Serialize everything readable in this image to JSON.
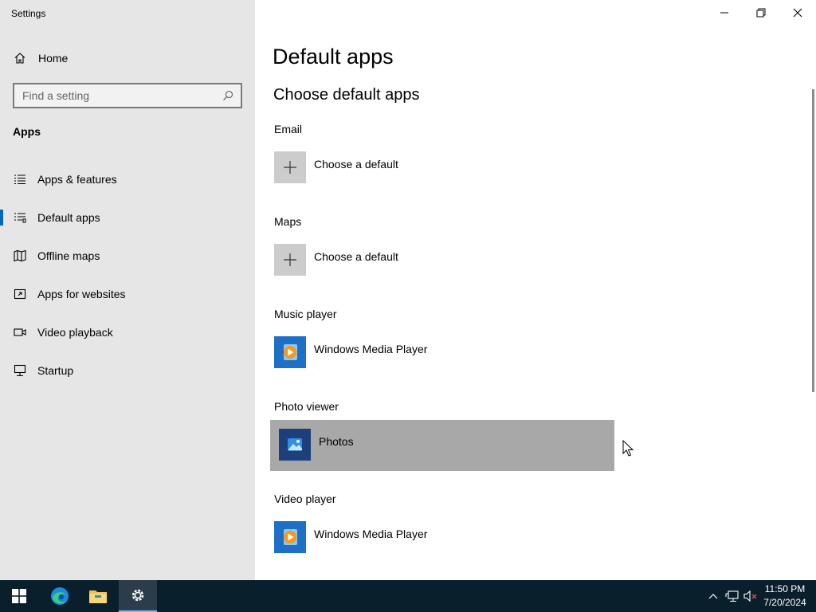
{
  "window": {
    "title": "Settings"
  },
  "sidebar": {
    "home_label": "Home",
    "search_placeholder": "Find a setting",
    "section_title": "Apps",
    "items": [
      {
        "label": "Apps & features",
        "icon": "list-icon"
      },
      {
        "label": "Default apps",
        "icon": "default-apps-icon",
        "active": true
      },
      {
        "label": "Offline maps",
        "icon": "map-icon"
      },
      {
        "label": "Apps for websites",
        "icon": "open-link-icon"
      },
      {
        "label": "Video playback",
        "icon": "video-icon"
      },
      {
        "label": "Startup",
        "icon": "startup-icon"
      }
    ]
  },
  "main": {
    "title": "Default apps",
    "subtitle": "Choose default apps",
    "categories": [
      {
        "label": "Email",
        "app": "Choose a default",
        "icon": "plus-icon"
      },
      {
        "label": "Maps",
        "app": "Choose a default",
        "icon": "plus-icon"
      },
      {
        "label": "Music player",
        "app": "Windows Media Player",
        "icon": "windows-media-player-icon"
      },
      {
        "label": "Photo viewer",
        "app": "Photos",
        "icon": "photos-icon",
        "hovered": true
      },
      {
        "label": "Video player",
        "app": "Windows Media Player",
        "icon": "windows-media-player-icon"
      }
    ]
  },
  "taskbar": {
    "apps": [
      "start-icon",
      "edge-icon",
      "file-explorer-icon",
      "settings-icon"
    ],
    "clock_time": "11:50 PM",
    "clock_date": "7/20/2024"
  },
  "colors": {
    "sidebar_bg": "#e6e6e6",
    "accent": "#0067c0",
    "taskbar_bg": "#0a1f2c",
    "hover_row": "#a8a8a8"
  }
}
